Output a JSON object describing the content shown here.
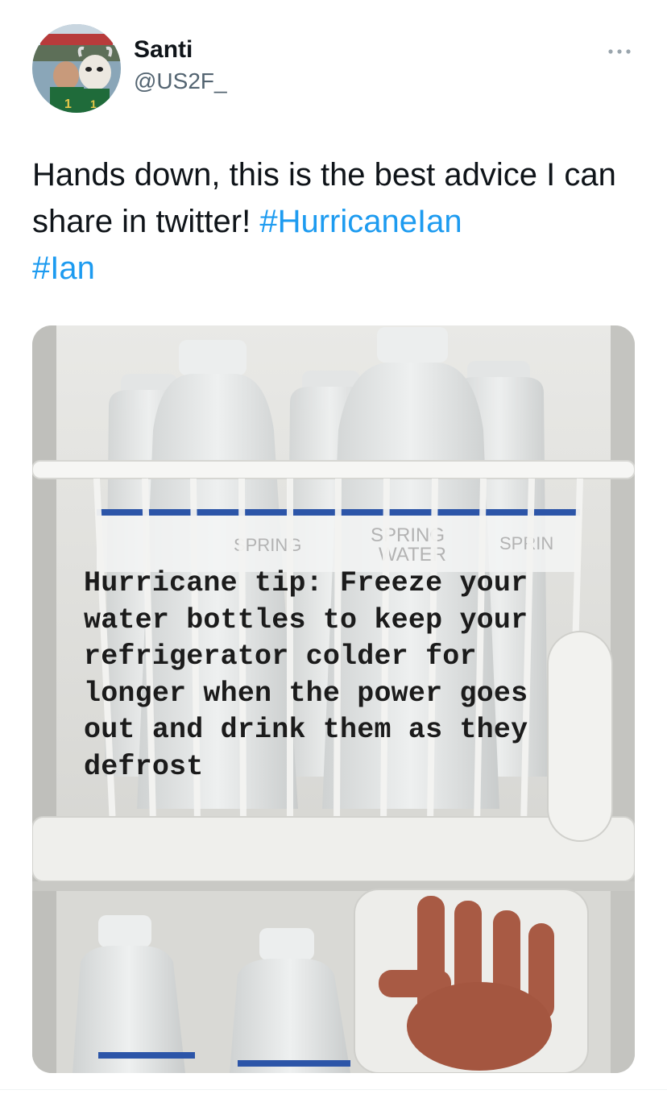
{
  "tweet": {
    "author": {
      "display_name": "Santi",
      "handle": "@US2F_",
      "avatar_icon": "profile-photo-avatar"
    },
    "more_icon": "more-horizontal-icon",
    "text_part1": "Hands down, this is the best advice I can share in twitter! ",
    "hashtag1": "#HurricaneIan",
    "hashtag2": "#Ian",
    "media": {
      "overlay_text": "Hurricane tip: Freeze your\nwater bottles to keep your\nrefrigerator colder for\nlonger when the power goes\nout and drink them as they\ndefrost",
      "bottle_label_text": "SPRING WATER"
    }
  },
  "colors": {
    "link": "#1d9bf0",
    "text": "#0f1419",
    "secondary": "#536471"
  }
}
